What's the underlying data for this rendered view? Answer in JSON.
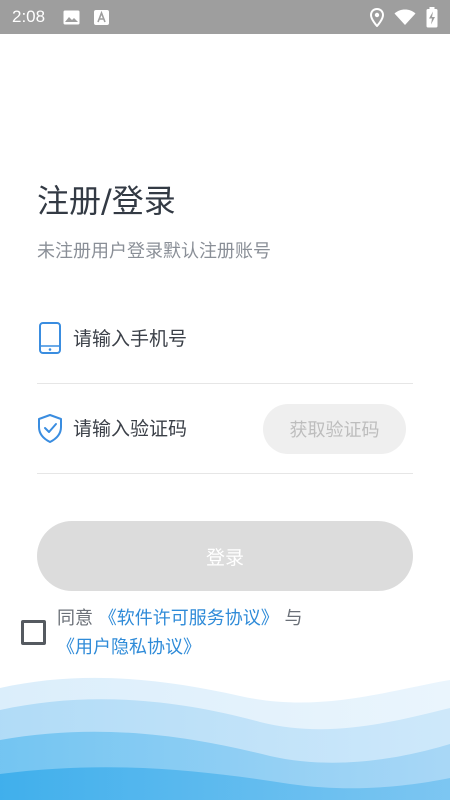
{
  "status_bar": {
    "time": "2:08",
    "left_icons": [
      "image-icon",
      "a-icon"
    ],
    "right_icons": [
      "location-icon",
      "wifi-icon",
      "battery-charging-icon"
    ],
    "color": "#9e9e9e"
  },
  "header": {
    "title": "注册/登录",
    "subtitle": "未注册用户登录默认注册账号"
  },
  "form": {
    "phone": {
      "placeholder": "请输入手机号",
      "value": "",
      "icon": "phone-icon"
    },
    "code": {
      "placeholder": "请输入验证码",
      "value": "",
      "icon": "shield-check-icon"
    },
    "get_code_label": "获取验证码",
    "login_label": "登录"
  },
  "agreement": {
    "checked": false,
    "prefix": "同意",
    "link_software": "《软件许可服务协议》",
    "connector": "与",
    "link_privacy": "《用户隐私协议》"
  },
  "colors": {
    "link": "#2f8bd8",
    "icon": "#3a8de0",
    "button_disabled": "#dcdcdc",
    "title": "#333a44"
  }
}
